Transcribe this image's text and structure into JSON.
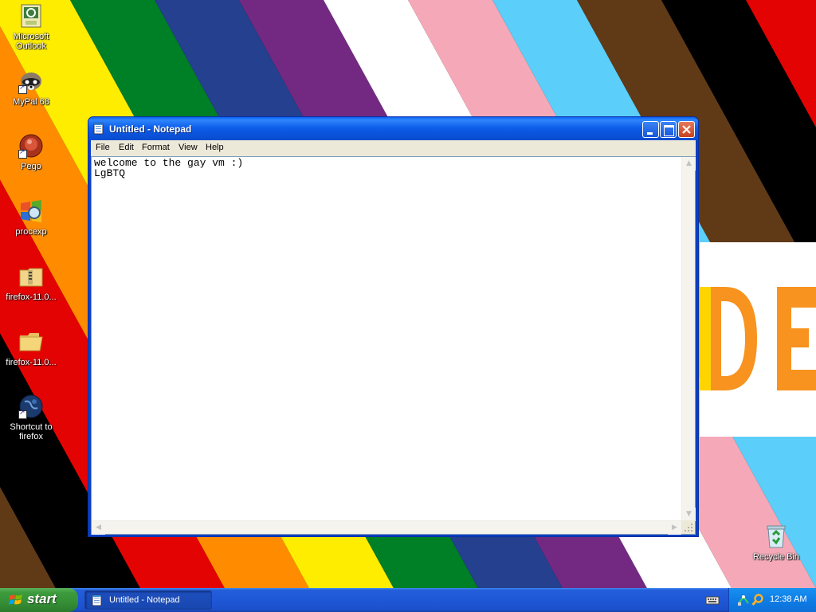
{
  "desktop": {
    "icons": [
      {
        "label": "Microsoft Outlook",
        "icon": "outlook-icon"
      },
      {
        "label": "MyPal 68",
        "icon": "mypal-raccoon-icon"
      },
      {
        "label": "Pego",
        "icon": "pego-icon"
      },
      {
        "label": "procexp",
        "icon": "process-explorer-icon"
      },
      {
        "label": "firefox-11.0...",
        "icon": "zip-folder-icon"
      },
      {
        "label": "firefox-11.0...",
        "icon": "folder-icon"
      },
      {
        "label": "Shortcut to firefox",
        "icon": "firefox-globe-icon"
      },
      {
        "label": "Recycle Bin",
        "icon": "recycle-bin-icon"
      }
    ],
    "wallpaper_text": "DE",
    "wallpaper_colors": [
      "#ffffff",
      "#f5a9b8",
      "#5bcefa",
      "#603a17",
      "#000000",
      "#e40303",
      "#ff8c00",
      "#ffed00",
      "#008026",
      "#24408e",
      "#732982"
    ]
  },
  "notepad": {
    "title": "Untitled - Notepad",
    "menu": [
      "File",
      "Edit",
      "Format",
      "View",
      "Help"
    ],
    "content": "welcome to the gay vm :)\nLgBTQ"
  },
  "taskbar": {
    "start_label": "start",
    "tasks": [
      {
        "label": "Untitled - Notepad",
        "icon": "notepad-icon"
      }
    ],
    "tray_icons": [
      "network-icon",
      "search-icon"
    ],
    "clock": "12:38 AM"
  }
}
